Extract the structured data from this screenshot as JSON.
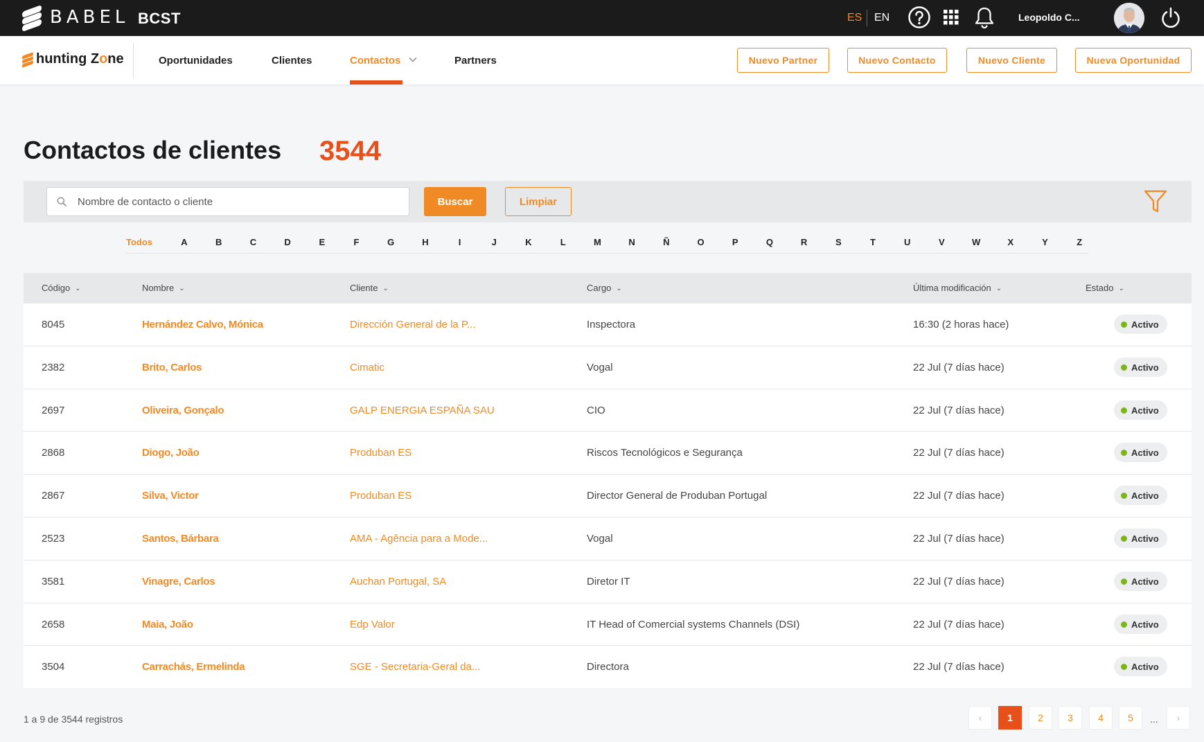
{
  "topbar": {
    "brand": "BABEL",
    "product": "BCST",
    "lang_es": "ES",
    "lang_en": "EN",
    "user_name": "Leopoldo C..."
  },
  "nav": {
    "logo_pre": "hunting Z",
    "logo_o": "o",
    "logo_post": "ne",
    "items": [
      "Oportunidades",
      "Clientes",
      "Contactos",
      "Partners"
    ],
    "active": "Contactos",
    "buttons": [
      "Nuevo Partner",
      "Nuevo Contacto",
      "Nuevo Cliente",
      "Nueva Oportunidad"
    ]
  },
  "page": {
    "title": "Contactos de clientes",
    "count": "3544"
  },
  "search": {
    "placeholder": "Nombre de contacto o cliente",
    "search_label": "Buscar",
    "clear_label": "Limpiar"
  },
  "alphabet": [
    "Todos",
    "A",
    "B",
    "C",
    "D",
    "E",
    "F",
    "G",
    "H",
    "I",
    "J",
    "K",
    "L",
    "M",
    "N",
    "Ñ",
    "O",
    "P",
    "Q",
    "R",
    "S",
    "T",
    "U",
    "V",
    "W",
    "X",
    "Y",
    "Z"
  ],
  "table": {
    "headers": [
      "Código",
      "Nombre",
      "Cliente",
      "Cargo",
      "Última modificación",
      "Estado"
    ],
    "rows": [
      {
        "code": "8045",
        "name": "Hernández Calvo, Mónica",
        "client": "Dirección General de la P...",
        "role": "Inspectora",
        "modified": "16:30 (2 horas hace)",
        "status": "Activo"
      },
      {
        "code": "2382",
        "name": "Brito, Carlos",
        "client": "Cimatic",
        "role": "Vogal",
        "modified": "22 Jul (7 días hace)",
        "status": "Activo"
      },
      {
        "code": "2697",
        "name": "Oliveira, Gonçalo",
        "client": "GALP ENERGIA ESPAÑA SAU",
        "role": "CIO",
        "modified": "22 Jul (7 días hace)",
        "status": "Activo"
      },
      {
        "code": "2868",
        "name": "Diogo, João",
        "client": "Produban ES",
        "role": "Riscos Tecnológicos e Segurança",
        "modified": "22 Jul (7 días hace)",
        "status": "Activo"
      },
      {
        "code": "2867",
        "name": "Silva, Victor",
        "client": "Produban ES",
        "role": "Director General de Produban Portugal",
        "modified": "22 Jul (7 días hace)",
        "status": "Activo"
      },
      {
        "code": "2523",
        "name": "Santos, Bárbara",
        "client": "AMA - Agência para a Mode...",
        "role": "Vogal",
        "modified": "22 Jul (7 días hace)",
        "status": "Activo"
      },
      {
        "code": "3581",
        "name": "Vinagre, Carlos",
        "client": "Auchan Portugal, SA",
        "role": "Diretor IT",
        "modified": "22 Jul (7 días hace)",
        "status": "Activo"
      },
      {
        "code": "2658",
        "name": "Maia, João",
        "client": "Edp Valor",
        "role": "IT Head of Comercial systems Channels (DSI)",
        "modified": "22 Jul (7 días hace)",
        "status": "Activo"
      },
      {
        "code": "3504",
        "name": "Carrachás, Ermelinda",
        "client": "SGE - Secretaria-Geral da...",
        "role": "Directora",
        "modified": "22 Jul (7 días hace)",
        "status": "Activo"
      }
    ]
  },
  "footer": {
    "records": "1 a 9 de 3544 registros",
    "pages": [
      "1",
      "2",
      "3",
      "4",
      "5"
    ],
    "current_page": "1",
    "ellipsis": "...",
    "prev": "‹",
    "next": "›"
  },
  "colors": {
    "accent": "#f08a24",
    "accent_dark": "#e8501a",
    "status_active": "#7cb518",
    "topbar": "#1b1b1b"
  }
}
